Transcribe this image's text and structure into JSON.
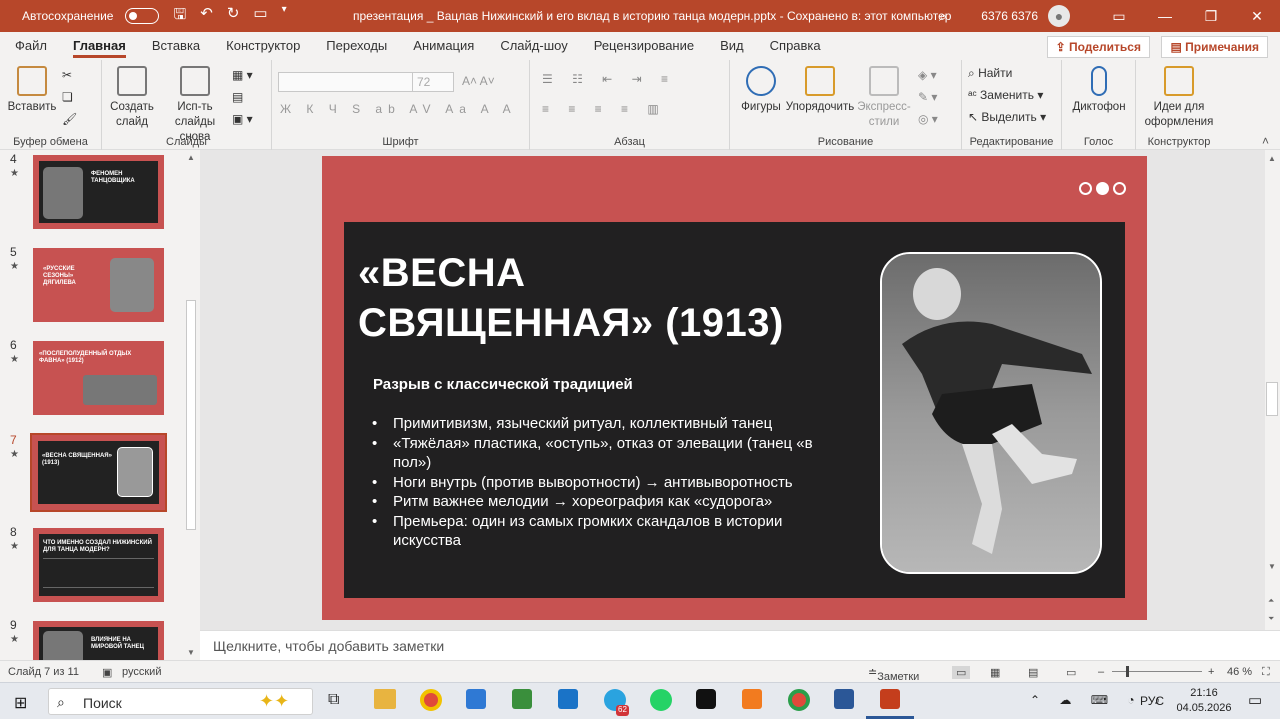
{
  "titlebar": {
    "autosave_label": "Автосохранение",
    "autosave_state": "off",
    "document_title": "презентация _ Вацлав Нижинский и его вклад в историю танца модерн.pptx  -  Сохранено в: этот компьютер",
    "user": "6376 6376",
    "accent_color": "#b7472a"
  },
  "menu": {
    "items": [
      "Файл",
      "Главная",
      "Вставка",
      "Конструктор",
      "Переходы",
      "Анимация",
      "Слайд-шоу",
      "Рецензирование",
      "Вид",
      "Справка"
    ],
    "active": "Главная",
    "share_label": "Поделиться",
    "comments_label": "Примечания"
  },
  "ribbon": {
    "clipboard": {
      "paste": "Вставить",
      "label": "Буфер обмена"
    },
    "slides": {
      "new_slide": "Создать слайд",
      "reuse": "Исп-ть слайды снова",
      "label": "Слайды"
    },
    "font": {
      "size": "72",
      "label": "Шрифт"
    },
    "paragraph": {
      "label": "Абзац"
    },
    "drawing": {
      "shapes": "Фигуры",
      "arrange": "Упорядочить",
      "styles": "Экспресс-стили",
      "label": "Рисование"
    },
    "editing": {
      "find": "Найти",
      "replace": "Заменить",
      "select": "Выделить",
      "label": "Редактирование"
    },
    "voice": {
      "dictate": "Диктофон",
      "label": "Голос"
    },
    "designer": {
      "ideas": "Идеи для оформления",
      "label": "Конструктор"
    }
  },
  "thumbnails": [
    {
      "num": "4",
      "title": "ФЕНОМЕН ТАНЦОВЩИКА"
    },
    {
      "num": "5",
      "title": "«РУССКИЕ СЕЗОНЫ» ДЯГИЛЕВА"
    },
    {
      "num": "6",
      "title": "«ПОСЛЕПОЛУДЕННЫЙ ОТДЫХ ФАВНА» (1912)"
    },
    {
      "num": "7",
      "title": "«ВЕСНА СВЯЩЕННАЯ» (1913)",
      "selected": true
    },
    {
      "num": "8",
      "title": "ЧТО ИМЕННО СОЗДАЛ НИЖИНСКИЙ ДЛЯ ТАНЦА МОДЕРН?"
    },
    {
      "num": "9",
      "title": "ВЛИЯНИЕ НА МИРОВОЙ ТАНЕЦ"
    }
  ],
  "slide": {
    "title_line1": "«ВЕСНА",
    "title_line2": "СВЯЩЕННАЯ» (1913)",
    "subhead": "Разрыв с классической традицией",
    "bullets": [
      "Примитивизм, языческий ритуал, коллективный танец",
      "«Тяжёлая» пластика, «оступь», отказ от элевации (танец «в пол»)",
      "Ноги внутрь (против выворотности) → антивыворотность",
      "Ритм важнее мелодии → хореография как «судорога»",
      "Премьера: один из самых громких скандалов в истории искусства"
    ],
    "bg_color": "#c75251",
    "panel_color": "#212021"
  },
  "notes_placeholder": "Щелкните, чтобы добавить заметки",
  "status": {
    "slide_counter": "Слайд 7 из 11",
    "language": "русский",
    "notes_label": "Заметки",
    "zoom": "46 %"
  },
  "taskbar": {
    "search_label": "Поиск",
    "lang": "РУС",
    "time": "21:16",
    "date": "04.05.2026",
    "telegram_badge": "62"
  }
}
